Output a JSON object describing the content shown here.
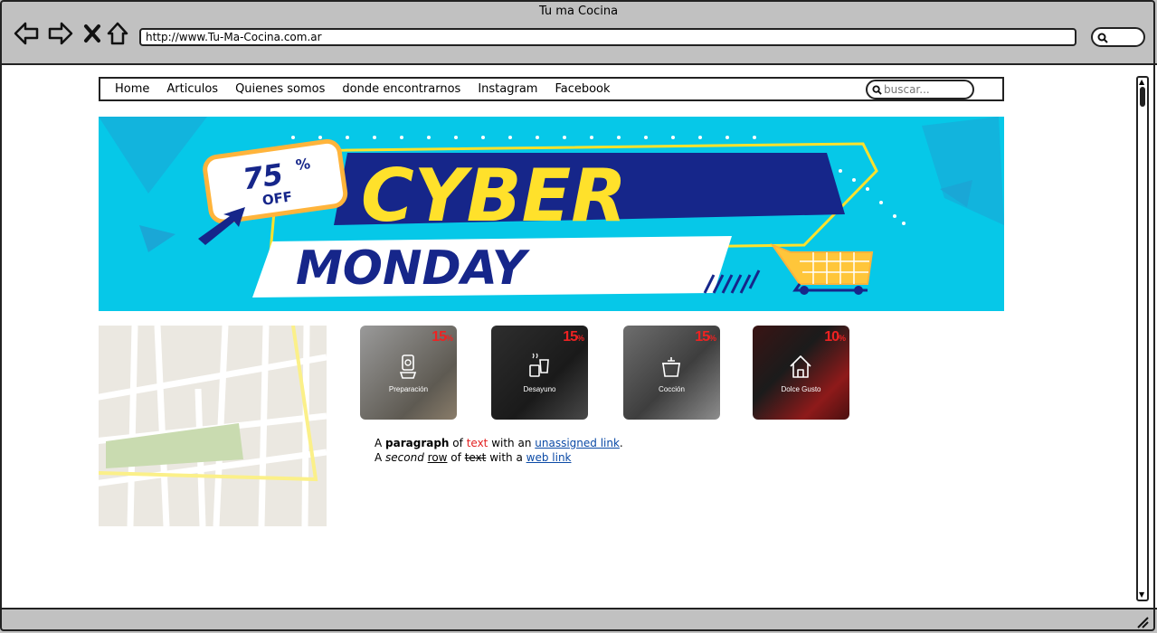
{
  "window": {
    "title": "Tu ma Cocina"
  },
  "address_bar": {
    "url": "http://www.Tu-Ma-Cocina.com.ar"
  },
  "nav": {
    "items": [
      "Home",
      "Articulos",
      "Quienes somos",
      "donde encontrarnos",
      "Instagram",
      "Facebook"
    ],
    "search_placeholder": "buscar..."
  },
  "banner": {
    "discount": "75",
    "percent": "%",
    "off": "OFF",
    "line1": "CYBER",
    "line2": "MONDAY"
  },
  "tiles": [
    {
      "label": "Preparación",
      "discount": "15",
      "icon": "blender-icon"
    },
    {
      "label": "Desayuno",
      "discount": "15",
      "icon": "breakfast-icon"
    },
    {
      "label": "Cocción",
      "discount": "15",
      "icon": "pot-icon"
    },
    {
      "label": "Dolce Gusto",
      "discount": "10",
      "icon": "home-icon"
    }
  ],
  "paragraph": {
    "r1_a": "A ",
    "r1_bold": "paragraph",
    "r1_of": " of ",
    "r1_red": "text",
    "r1_with": " with an ",
    "r1_link": "unassigned link",
    "r1_end": ".",
    "r2_a": "A ",
    "r2_italic": "second",
    "r2_sp": " ",
    "r2_under": "row",
    "r2_of": " of ",
    "r2_strike": "text",
    "r2_with": " with a ",
    "r2_link": "web link"
  },
  "colors": {
    "chrome": "#c1c1c1",
    "banner_bg": "#06c8e8",
    "banner_navy": "#16268a",
    "banner_yellow": "#ffe12b",
    "discount_red": "#e22222",
    "link": "#0b4aa6"
  }
}
